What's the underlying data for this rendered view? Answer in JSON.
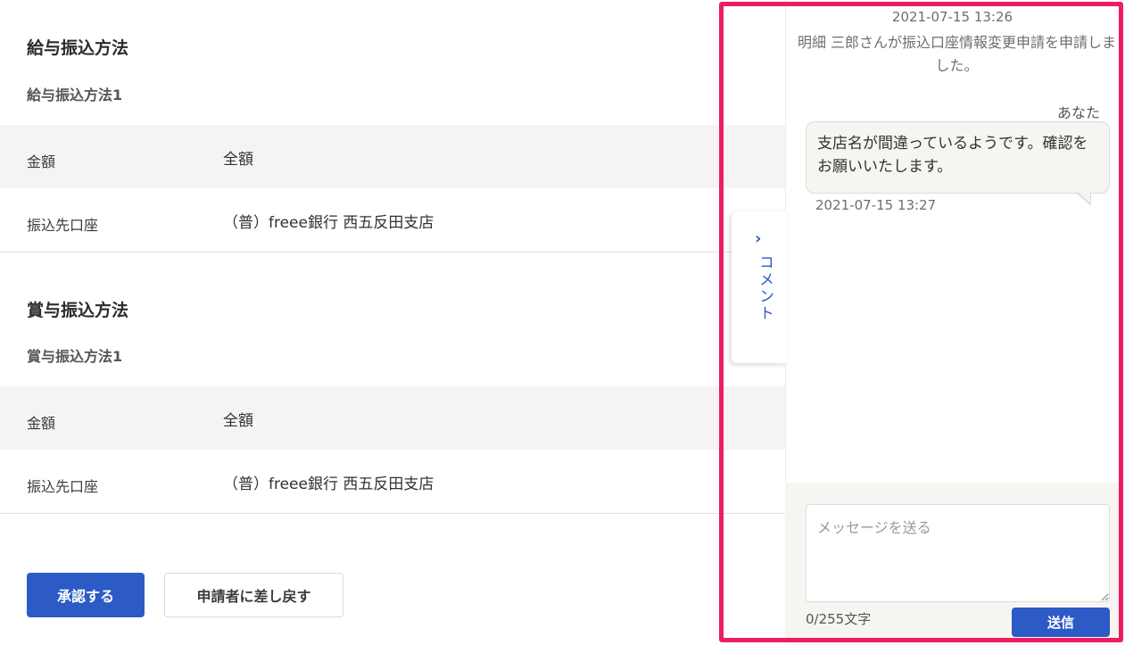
{
  "salary_section": {
    "title": "給与振込方法",
    "subtitle": "給与振込方法1",
    "rows": [
      {
        "label": "金額",
        "value": "全額"
      },
      {
        "label": "振込先口座",
        "value": "（普）freee銀行 西五反田支店"
      }
    ]
  },
  "bonus_section": {
    "title": "賞与振込方法",
    "subtitle": "賞与振込方法1",
    "rows": [
      {
        "label": "金額",
        "value": "全額"
      },
      {
        "label": "振込先口座",
        "value": "（普）freee銀行 西五反田支店"
      }
    ]
  },
  "actions": {
    "approve_label": "承認する",
    "return_label": "申請者に差し戻す"
  },
  "comment_tab": {
    "chevron": "›",
    "label": "コメント"
  },
  "comments": {
    "system_time": "2021-07-15 13:26",
    "system_message": "明細 三郎さんが振込口座情報変更申請を申請しました。",
    "author": "あなた",
    "message": "支店名が間違っているようです。確認をお願いいたします。",
    "message_time": "2021-07-15 13:27"
  },
  "composer": {
    "placeholder": "メッセージを送る",
    "char_count": "0/255文字",
    "send_label": "送信"
  },
  "colors": {
    "primary": "#2c5bc6",
    "highlight": "#ef1c64",
    "row_shade": "#f5f3f3",
    "bubble_bg": "#f6f5f1"
  }
}
